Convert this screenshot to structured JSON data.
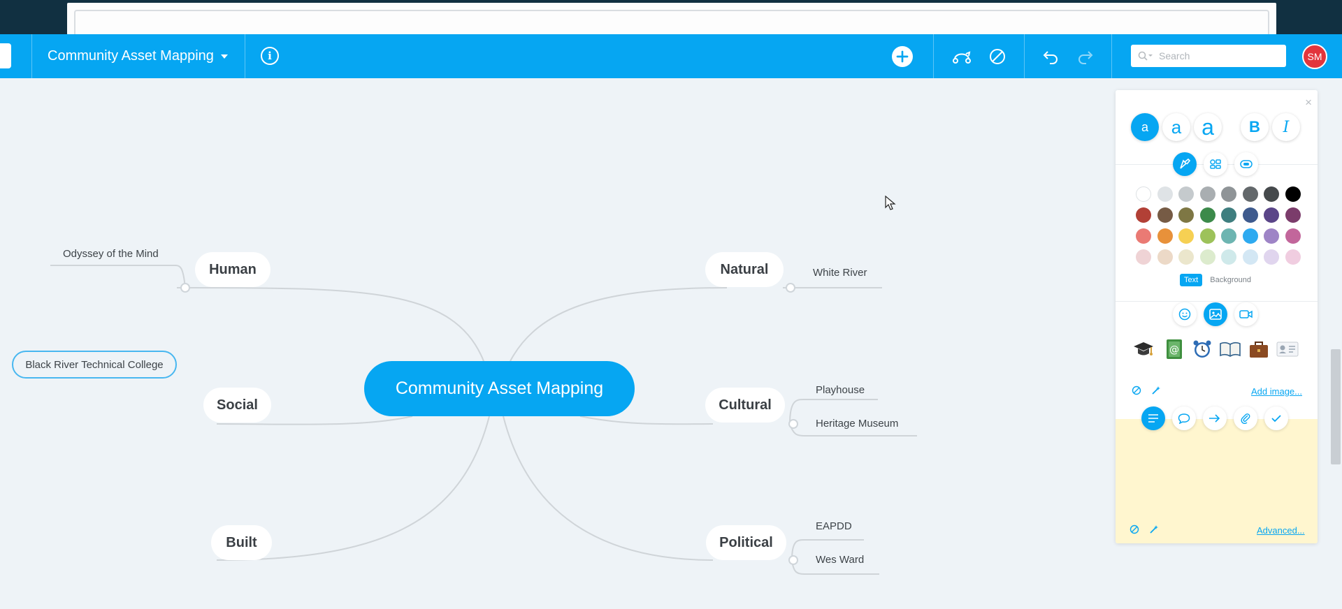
{
  "header": {
    "map_title": "Community Asset Mapping",
    "search_placeholder": "Search",
    "avatar_initials": "SM",
    "info_icon": "i"
  },
  "mindmap": {
    "central": "Community Asset Mapping",
    "branches": {
      "human": {
        "label": "Human",
        "children": [
          "Odyssey of the Mind",
          "Black River Technical College"
        ]
      },
      "social": {
        "label": "Social"
      },
      "built": {
        "label": "Built"
      },
      "natural": {
        "label": "Natural",
        "children": [
          "White River"
        ]
      },
      "cultural": {
        "label": "Cultural",
        "children": [
          "Playhouse",
          "Heritage Museum"
        ]
      },
      "political": {
        "label": "Political",
        "children": [
          "EAPDD",
          "Wes Ward"
        ]
      }
    }
  },
  "panel": {
    "close": "×",
    "font_small": "a",
    "font_medium": "a",
    "font_large": "a",
    "bold": "B",
    "italic": "I",
    "color_target_text": "Text",
    "color_target_background": "Background",
    "add_image": "Add image...",
    "advanced": "Advanced...",
    "colors": {
      "row1": [
        "#ffffff",
        "#dfe3e6",
        "#c5cacd",
        "#a9aeb1",
        "#8f9497",
        "#63686b",
        "#45494c",
        "#000000"
      ],
      "row2": [
        "#b24036",
        "#765b45",
        "#7e7744",
        "#3c8a4a",
        "#3f7e7f",
        "#3e5a8d",
        "#5a4588",
        "#7b3c6b"
      ],
      "row3": [
        "#ea7a74",
        "#e8913a",
        "#f6d053",
        "#9dc25a",
        "#6db5b1",
        "#2eaaf0",
        "#9e84c6",
        "#c2669b"
      ],
      "row4": [
        "#efd3d5",
        "#ecd9c7",
        "#ebe6cc",
        "#dcebcd",
        "#cfe9ea",
        "#d3e7f4",
        "#e0d5ee",
        "#f0cde0"
      ]
    }
  }
}
